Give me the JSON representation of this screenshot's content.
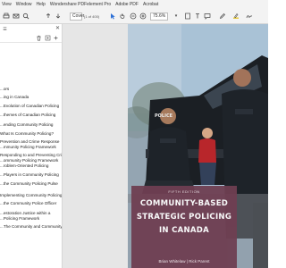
{
  "menubar": {
    "items": [
      "Window",
      "Help",
      "Wondershare PDFelement Pro",
      "Adobe PDF",
      "Acrobat"
    ],
    "visible": [
      "...dit",
      "View",
      "Window",
      "Help",
      "Wondershare PDFelement Pro",
      "Adobe PDF",
      "Acrobat"
    ]
  },
  "toolbar": {
    "page_current": "Cover",
    "page_count": "(1 of 400)",
    "zoom": "75.6%",
    "icons": [
      "print-icon",
      "mail-icon",
      "search-icon",
      "upload-icon",
      "download-icon",
      "pointer-icon",
      "hand-icon",
      "zoom-out-icon",
      "zoom-in-icon",
      "fit-page-icon",
      "text-select-icon",
      "comment-icon",
      "pen-icon",
      "highlight-icon",
      "sign-icon"
    ]
  },
  "sidebar": {
    "header": "Bookmarks",
    "bookmarks": [
      "Cover",
      "...nts",
      "...ors",
      "...ing in Canada",
      "...Evolution of Canadian Policing",
      "...themes of Canadian Policing",
      "...ending Community Policing",
      "What Is Community Policing?",
      "Prevention and Crime Response",
      "...mmunity Policing Framework",
      "Responding to and Preventing Crime",
      "...ommunity Policing Framework",
      "...roblem-Oriented Policing",
      "...Players in Community Policing",
      "...the Community Policing Pulse",
      "Implementing Community Policing",
      "...the Community Police Officer",
      "...estoration Justice within a",
      "...Policing Framework",
      "...The Community and Community"
    ]
  },
  "book": {
    "edition": "FIFTH EDITION",
    "title_lines": [
      "COMMUNITY-BASED",
      "STRATEGIC POLICING",
      "IN CANADA"
    ],
    "authors": "Brian Whitelaw | Rick Parent",
    "badge_police": "POLICE"
  },
  "colors": {
    "title_box": "#6f3f52",
    "sky": "#9fb9cf",
    "uniform": "#1e2329"
  }
}
